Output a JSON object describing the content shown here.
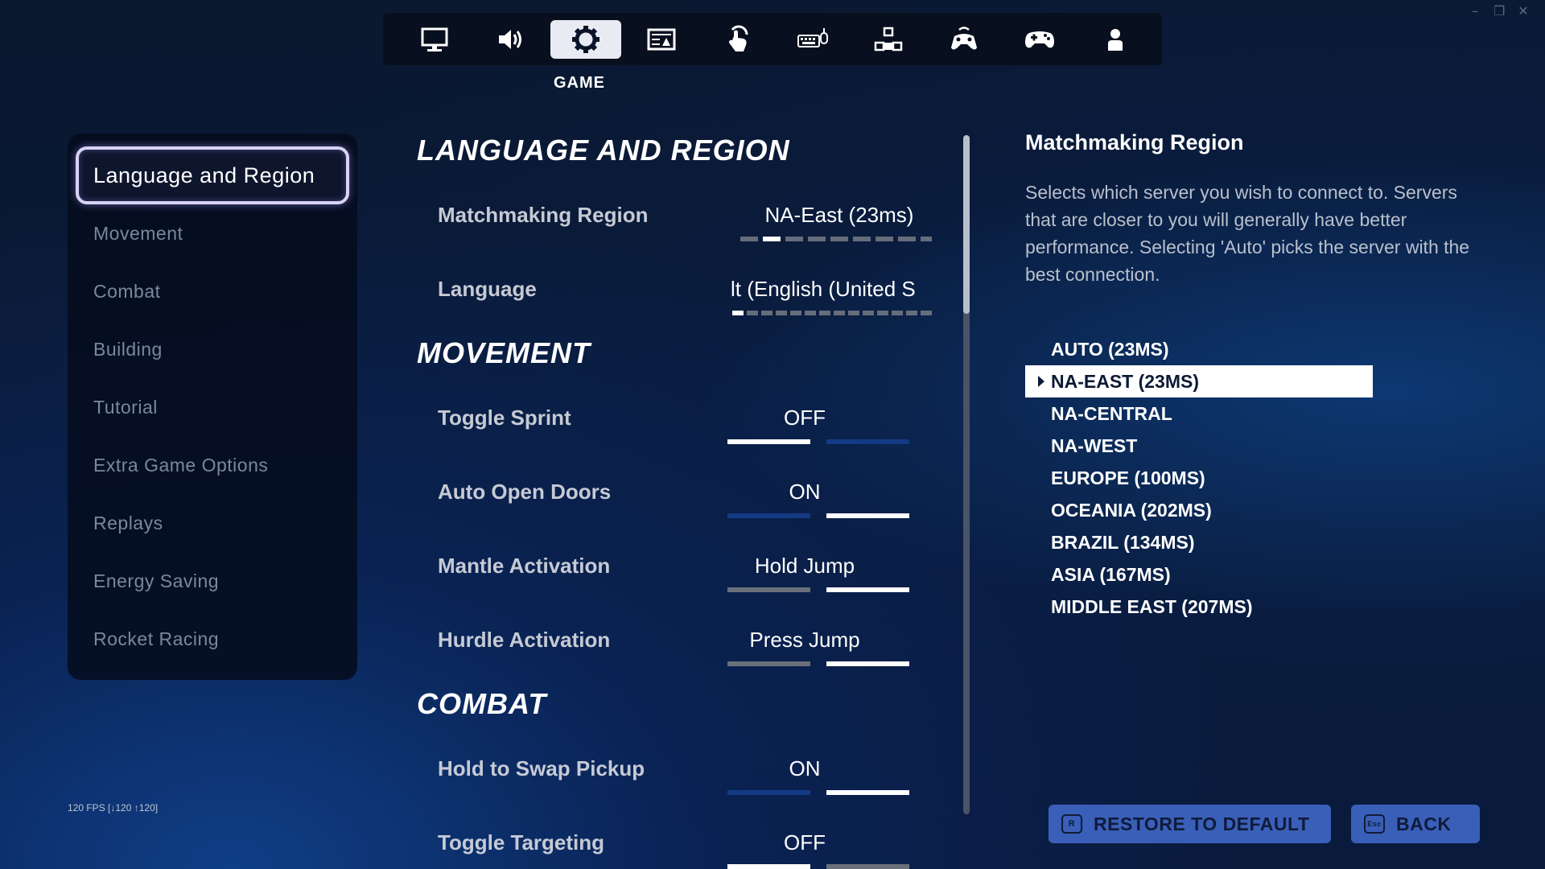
{
  "window": {
    "minimize": "–",
    "restore": "❐",
    "close": "✕"
  },
  "nav": {
    "active_caption": "GAME",
    "tabs": [
      {
        "icon": "monitor-icon"
      },
      {
        "icon": "speaker-icon"
      },
      {
        "icon": "gear-icon",
        "active": true
      },
      {
        "icon": "subtitles-icon"
      },
      {
        "icon": "touch-icon"
      },
      {
        "icon": "keyboard-mouse-icon"
      },
      {
        "icon": "controller-buttons-icon"
      },
      {
        "icon": "wireless-controller-icon"
      },
      {
        "icon": "controller-icon"
      },
      {
        "icon": "account-icon"
      }
    ]
  },
  "sidebar": {
    "items": [
      {
        "label": "Language and Region",
        "active": true
      },
      {
        "label": "Movement"
      },
      {
        "label": "Combat"
      },
      {
        "label": "Building"
      },
      {
        "label": "Tutorial"
      },
      {
        "label": "Extra Game Options"
      },
      {
        "label": "Replays"
      },
      {
        "label": "Energy Saving"
      },
      {
        "label": "Rocket Racing"
      }
    ]
  },
  "fps": "120 FPS [↓120 ↑120]",
  "settings": {
    "language_region_title": "LANGUAGE AND REGION",
    "matchmaking": {
      "label": "Matchmaking Region",
      "value": "NA-East (23ms)"
    },
    "language": {
      "label": "Language",
      "value": "lt (English (United S"
    },
    "movement_title": "MOVEMENT",
    "toggle_sprint": {
      "label": "Toggle Sprint",
      "value": "OFF"
    },
    "auto_open_doors": {
      "label": "Auto Open Doors",
      "value": "ON"
    },
    "mantle": {
      "label": "Mantle Activation",
      "value": "Hold Jump"
    },
    "hurdle": {
      "label": "Hurdle Activation",
      "value": "Press Jump"
    },
    "combat_title": "COMBAT",
    "hold_swap": {
      "label": "Hold to Swap Pickup",
      "value": "ON"
    },
    "toggle_targeting": {
      "label": "Toggle Targeting",
      "value": "OFF"
    }
  },
  "detail": {
    "title": "Matchmaking Region",
    "description": "Selects which server you wish to connect to. Servers that are closer to you will generally have better performance. Selecting 'Auto' picks the server with the best connection.",
    "options": [
      "AUTO (23MS)",
      "NA-EAST (23MS)",
      "NA-CENTRAL",
      "NA-WEST",
      "EUROPE (100MS)",
      "OCEANIA (202MS)",
      "BRAZIL (134MS)",
      "ASIA (167MS)",
      "MIDDLE EAST (207MS)"
    ],
    "selected_index": 1
  },
  "buttons": {
    "restore_key": "R",
    "restore_label": "RESTORE TO DEFAULT",
    "back_key": "Esc",
    "back_label": "BACK"
  }
}
